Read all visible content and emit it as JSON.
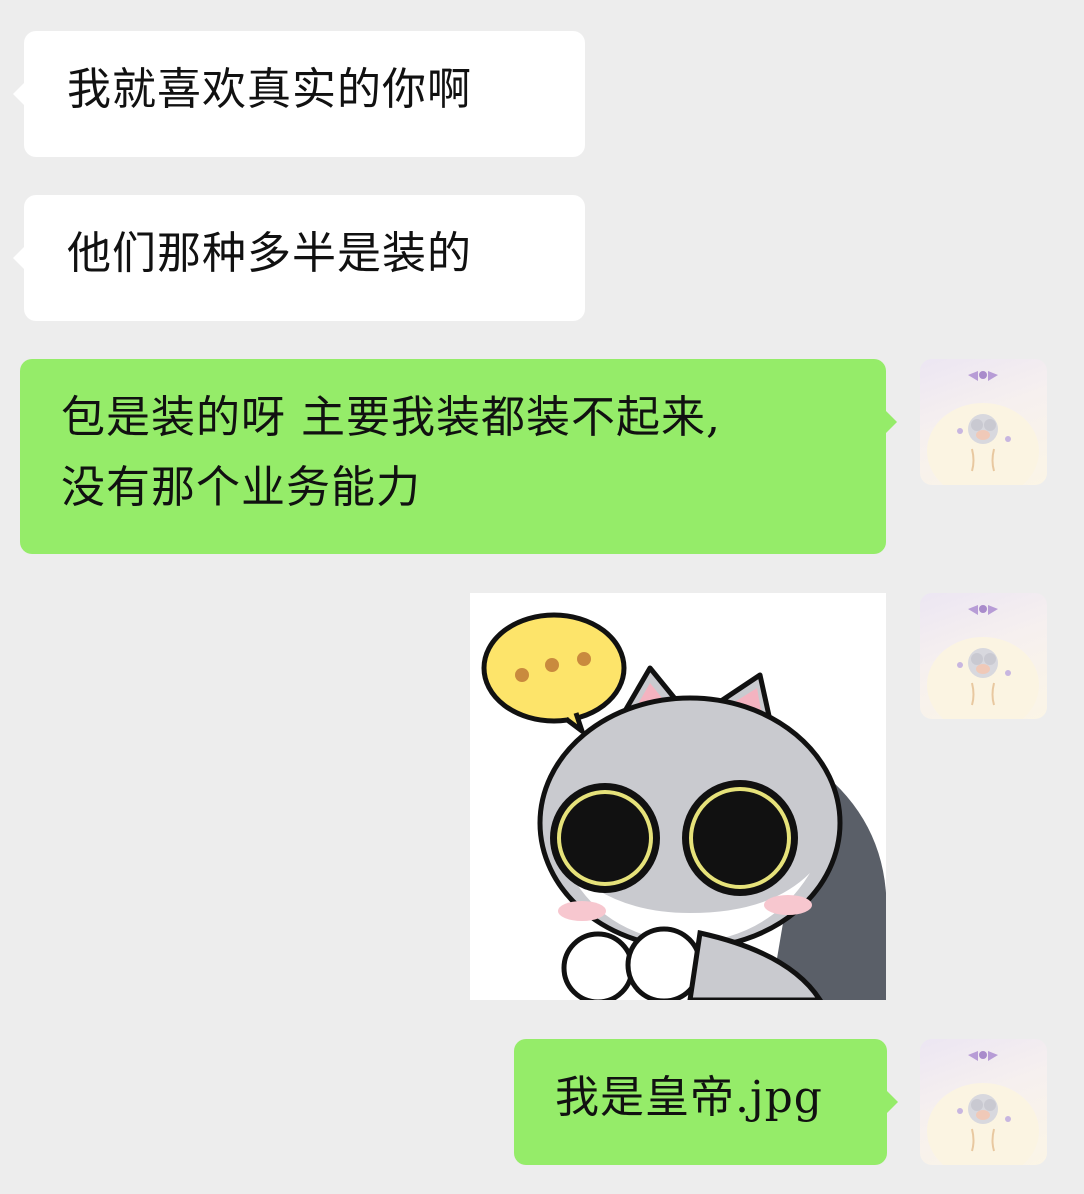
{
  "messages": [
    {
      "side": "left",
      "text": "我就喜欢真实的你啊"
    },
    {
      "side": "left",
      "text": "他们那种多半是装的"
    },
    {
      "side": "right",
      "lines": [
        "包是装的呀  主要我装都装不起来,",
        "没有那个业务能力"
      ]
    },
    {
      "side": "right",
      "type": "sticker",
      "icon": "cat-sticker-icon"
    },
    {
      "side": "right",
      "text": "我是皇帝.jpg"
    }
  ],
  "colors": {
    "background": "#ededed",
    "incoming_bubble": "#ffffff",
    "outgoing_bubble": "#95ec69"
  }
}
